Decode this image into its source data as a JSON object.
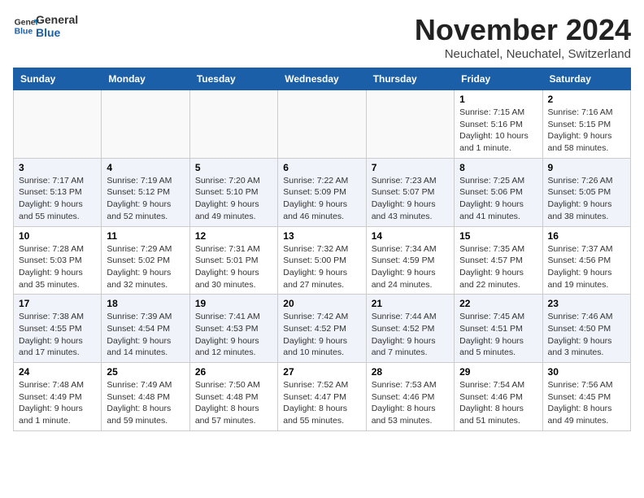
{
  "header": {
    "logo_general": "General",
    "logo_blue": "Blue",
    "month_title": "November 2024",
    "location": "Neuchatel, Neuchatel, Switzerland"
  },
  "weekdays": [
    "Sunday",
    "Monday",
    "Tuesday",
    "Wednesday",
    "Thursday",
    "Friday",
    "Saturday"
  ],
  "weeks": [
    [
      {
        "day": "",
        "info": ""
      },
      {
        "day": "",
        "info": ""
      },
      {
        "day": "",
        "info": ""
      },
      {
        "day": "",
        "info": ""
      },
      {
        "day": "",
        "info": ""
      },
      {
        "day": "1",
        "info": "Sunrise: 7:15 AM\nSunset: 5:16 PM\nDaylight: 10 hours\nand 1 minute."
      },
      {
        "day": "2",
        "info": "Sunrise: 7:16 AM\nSunset: 5:15 PM\nDaylight: 9 hours\nand 58 minutes."
      }
    ],
    [
      {
        "day": "3",
        "info": "Sunrise: 7:17 AM\nSunset: 5:13 PM\nDaylight: 9 hours\nand 55 minutes."
      },
      {
        "day": "4",
        "info": "Sunrise: 7:19 AM\nSunset: 5:12 PM\nDaylight: 9 hours\nand 52 minutes."
      },
      {
        "day": "5",
        "info": "Sunrise: 7:20 AM\nSunset: 5:10 PM\nDaylight: 9 hours\nand 49 minutes."
      },
      {
        "day": "6",
        "info": "Sunrise: 7:22 AM\nSunset: 5:09 PM\nDaylight: 9 hours\nand 46 minutes."
      },
      {
        "day": "7",
        "info": "Sunrise: 7:23 AM\nSunset: 5:07 PM\nDaylight: 9 hours\nand 43 minutes."
      },
      {
        "day": "8",
        "info": "Sunrise: 7:25 AM\nSunset: 5:06 PM\nDaylight: 9 hours\nand 41 minutes."
      },
      {
        "day": "9",
        "info": "Sunrise: 7:26 AM\nSunset: 5:05 PM\nDaylight: 9 hours\nand 38 minutes."
      }
    ],
    [
      {
        "day": "10",
        "info": "Sunrise: 7:28 AM\nSunset: 5:03 PM\nDaylight: 9 hours\nand 35 minutes."
      },
      {
        "day": "11",
        "info": "Sunrise: 7:29 AM\nSunset: 5:02 PM\nDaylight: 9 hours\nand 32 minutes."
      },
      {
        "day": "12",
        "info": "Sunrise: 7:31 AM\nSunset: 5:01 PM\nDaylight: 9 hours\nand 30 minutes."
      },
      {
        "day": "13",
        "info": "Sunrise: 7:32 AM\nSunset: 5:00 PM\nDaylight: 9 hours\nand 27 minutes."
      },
      {
        "day": "14",
        "info": "Sunrise: 7:34 AM\nSunset: 4:59 PM\nDaylight: 9 hours\nand 24 minutes."
      },
      {
        "day": "15",
        "info": "Sunrise: 7:35 AM\nSunset: 4:57 PM\nDaylight: 9 hours\nand 22 minutes."
      },
      {
        "day": "16",
        "info": "Sunrise: 7:37 AM\nSunset: 4:56 PM\nDaylight: 9 hours\nand 19 minutes."
      }
    ],
    [
      {
        "day": "17",
        "info": "Sunrise: 7:38 AM\nSunset: 4:55 PM\nDaylight: 9 hours\nand 17 minutes."
      },
      {
        "day": "18",
        "info": "Sunrise: 7:39 AM\nSunset: 4:54 PM\nDaylight: 9 hours\nand 14 minutes."
      },
      {
        "day": "19",
        "info": "Sunrise: 7:41 AM\nSunset: 4:53 PM\nDaylight: 9 hours\nand 12 minutes."
      },
      {
        "day": "20",
        "info": "Sunrise: 7:42 AM\nSunset: 4:52 PM\nDaylight: 9 hours\nand 10 minutes."
      },
      {
        "day": "21",
        "info": "Sunrise: 7:44 AM\nSunset: 4:52 PM\nDaylight: 9 hours\nand 7 minutes."
      },
      {
        "day": "22",
        "info": "Sunrise: 7:45 AM\nSunset: 4:51 PM\nDaylight: 9 hours\nand 5 minutes."
      },
      {
        "day": "23",
        "info": "Sunrise: 7:46 AM\nSunset: 4:50 PM\nDaylight: 9 hours\nand 3 minutes."
      }
    ],
    [
      {
        "day": "24",
        "info": "Sunrise: 7:48 AM\nSunset: 4:49 PM\nDaylight: 9 hours\nand 1 minute."
      },
      {
        "day": "25",
        "info": "Sunrise: 7:49 AM\nSunset: 4:48 PM\nDaylight: 8 hours\nand 59 minutes."
      },
      {
        "day": "26",
        "info": "Sunrise: 7:50 AM\nSunset: 4:48 PM\nDaylight: 8 hours\nand 57 minutes."
      },
      {
        "day": "27",
        "info": "Sunrise: 7:52 AM\nSunset: 4:47 PM\nDaylight: 8 hours\nand 55 minutes."
      },
      {
        "day": "28",
        "info": "Sunrise: 7:53 AM\nSunset: 4:46 PM\nDaylight: 8 hours\nand 53 minutes."
      },
      {
        "day": "29",
        "info": "Sunrise: 7:54 AM\nSunset: 4:46 PM\nDaylight: 8 hours\nand 51 minutes."
      },
      {
        "day": "30",
        "info": "Sunrise: 7:56 AM\nSunset: 4:45 PM\nDaylight: 8 hours\nand 49 minutes."
      }
    ]
  ]
}
